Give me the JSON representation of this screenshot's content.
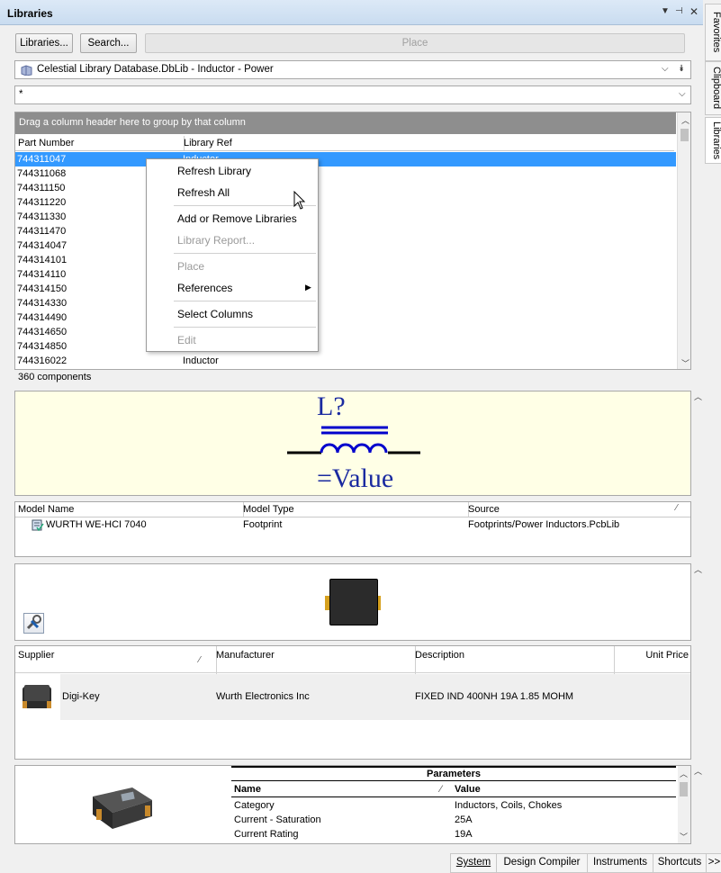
{
  "panel": {
    "title": "Libraries"
  },
  "toolbar": {
    "libraries": "Libraries...",
    "search": "Search...",
    "place": "Place"
  },
  "library_combo": {
    "value": "Celestial Library Database.DbLib - Inductor - Power"
  },
  "filter": {
    "value": "*"
  },
  "grid": {
    "group_hint": "Drag a column header here to group by that column",
    "columns": [
      "Part Number",
      "Library Ref"
    ],
    "rows": [
      "744311047",
      "744311068",
      "744311150",
      "744311220",
      "744311330",
      "744311470",
      "744314047",
      "744314101",
      "744314110",
      "744314150",
      "744314330",
      "744314490",
      "744314650",
      "744314850",
      "744316022"
    ],
    "last_row_ref": "Inductor",
    "first_row_ref": "Inductor",
    "count": "360 components"
  },
  "context_menu": {
    "items": [
      "Refresh Library",
      "Refresh All",
      "Add or Remove Libraries",
      "Library Report...",
      "Place",
      "References",
      "Select Columns",
      "Edit"
    ]
  },
  "symbol": {
    "designator": "L?",
    "value": "=Value"
  },
  "models": {
    "columns": [
      "Model Name",
      "Model Type",
      "Source"
    ],
    "row": {
      "name": "WURTH WE-HCI 7040",
      "type": "Footprint",
      "source": "Footprints/Power Inductors.PcbLib"
    }
  },
  "supplier": {
    "columns": [
      "Supplier",
      "Manufacturer",
      "Description",
      "Unit Price"
    ],
    "row": {
      "supplier": "Digi-Key",
      "manufacturer": "Wurth Electronics Inc",
      "description": "FIXED IND 400NH 19A 1.85 MOHM"
    }
  },
  "parameters": {
    "title": "Parameters",
    "columns": [
      "Name",
      "Value"
    ],
    "rows": [
      {
        "name": "Category",
        "value": "Inductors, Coils, Chokes"
      },
      {
        "name": "Current - Saturation",
        "value": "25A"
      },
      {
        "name": "Current Rating",
        "value": "19A"
      }
    ]
  },
  "side_tabs": [
    "Favorites",
    "Clipboard",
    "Libraries"
  ],
  "bottom_tabs": [
    "System",
    "Design Compiler",
    "Instruments",
    "Shortcuts",
    ">>"
  ],
  "colors": {
    "selection": "#3399ff",
    "symbol_blue": "#0000cc",
    "symbol_bg": "#ffffe6"
  }
}
